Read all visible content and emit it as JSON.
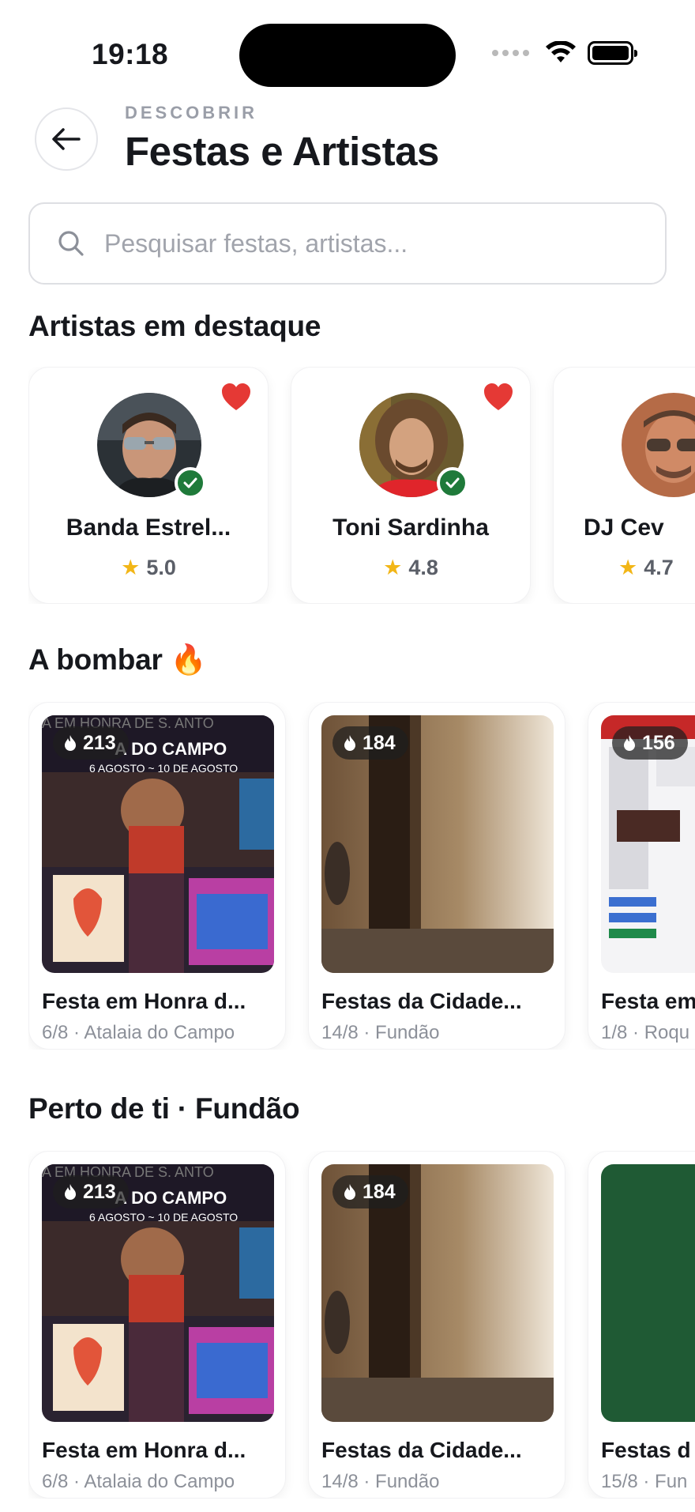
{
  "status_bar": {
    "time": "19:18"
  },
  "header": {
    "eyebrow": "DESCOBRIR",
    "title": "Festas e Artistas"
  },
  "search": {
    "placeholder": "Pesquisar festas, artistas..."
  },
  "featured_artists": {
    "title": "Artistas em destaque",
    "items": [
      {
        "name": "Banda Estrel...",
        "rating": "5.0",
        "favorite": true,
        "verified": true
      },
      {
        "name": "Toni Sardinha",
        "rating": "4.8",
        "favorite": true,
        "verified": true
      },
      {
        "name": "DJ Cev",
        "rating": "4.7",
        "favorite": false,
        "verified": false
      }
    ]
  },
  "trending": {
    "title": "A bombar 🔥",
    "items": [
      {
        "hot": "213",
        "title": "Festa em Honra d...",
        "meta": "6/8 · Atalaia do Campo"
      },
      {
        "hot": "184",
        "title": "Festas da Cidade...",
        "meta": "14/8 · Fundão"
      },
      {
        "hot": "156",
        "title": "Festa em",
        "meta": "1/8 · Roqu"
      }
    ]
  },
  "nearby": {
    "title": "Perto de ti · Fundão",
    "items": [
      {
        "hot": "213",
        "title": "Festa em Honra d...",
        "meta": "6/8 · Atalaia do Campo"
      },
      {
        "hot": "184",
        "title": "Festas da Cidade...",
        "meta": "14/8 · Fundão"
      },
      {
        "title": "Festas d",
        "meta": "15/8 · Fun"
      }
    ]
  },
  "colors": {
    "accent_red": "#e53935",
    "verified_green": "#1f7a3a",
    "star": "#f2b617",
    "poster_green": "#1f5a34"
  }
}
